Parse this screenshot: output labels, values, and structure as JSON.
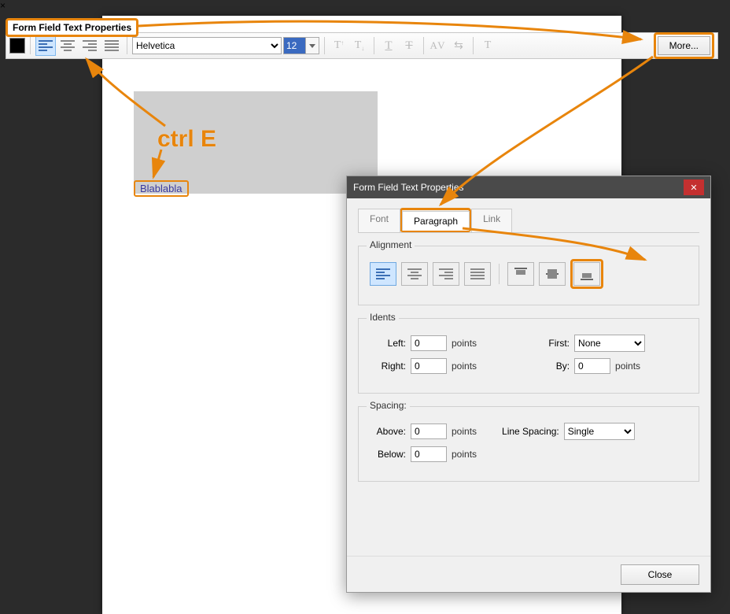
{
  "toolbar_title": "Form Field Text Properties",
  "annotation_text": "ctrl E",
  "sample_text": "Blablabla",
  "toolbar": {
    "font": "Helvetica",
    "size": "12",
    "more_label": "More...",
    "color": "#000000"
  },
  "dialog": {
    "title": "Form Field Text Properties",
    "tabs": {
      "font": "Font",
      "paragraph": "Paragraph",
      "link": "Link"
    },
    "alignment_legend": "Alignment",
    "indents": {
      "legend": "Idents",
      "left_label": "Left:",
      "left_value": "0",
      "right_label": "Right:",
      "right_value": "0",
      "first_label": "First:",
      "first_value": "None",
      "by_label": "By:",
      "by_value": "0",
      "unit": "points"
    },
    "spacing": {
      "legend": "Spacing:",
      "above_label": "Above:",
      "above_value": "0",
      "below_label": "Below:",
      "below_value": "0",
      "ls_label": "Line Spacing:",
      "ls_value": "Single",
      "unit": "points"
    },
    "close": "Close"
  }
}
